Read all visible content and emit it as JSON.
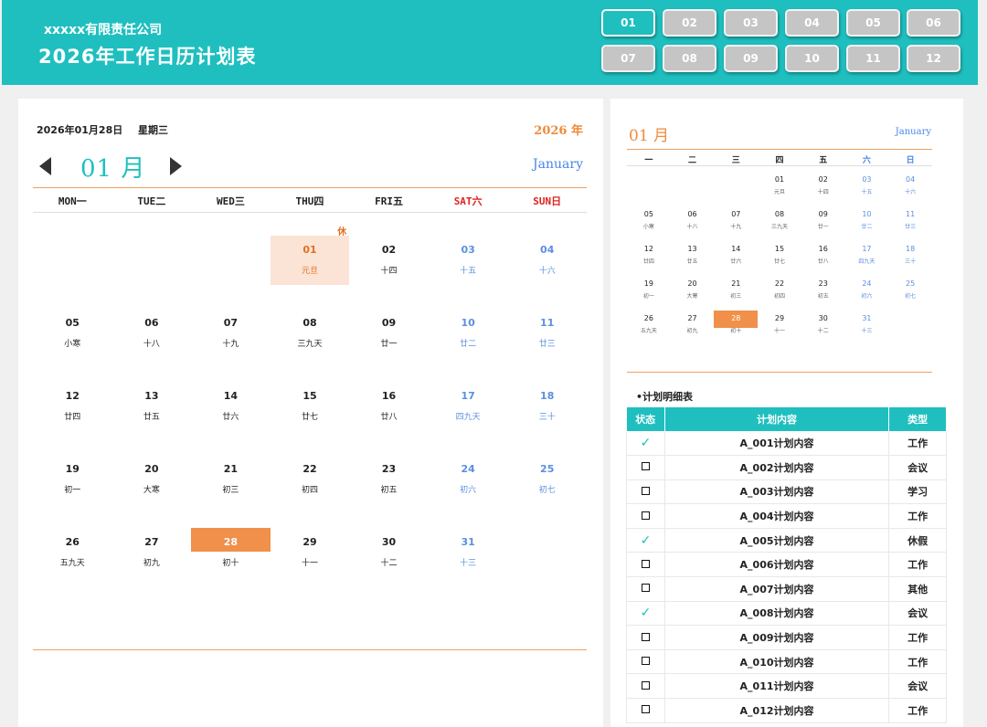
{
  "header": {
    "company": "xxxxx有限责任公司",
    "title": "2026年工作日历计划表",
    "months": [
      "01",
      "02",
      "03",
      "04",
      "05",
      "06",
      "07",
      "08",
      "09",
      "10",
      "11",
      "12"
    ],
    "active_month": "01"
  },
  "calendar": {
    "date": "2026年01月28日",
    "weekday": "星期三",
    "year": "2026 年",
    "month_cn": "01 月",
    "month_en": "January",
    "dow": [
      "MON一",
      "TUE二",
      "WED三",
      "THU四",
      "FRI五",
      "SAT六",
      "SUN日"
    ],
    "rest_label": "休",
    "days": [
      {
        "d": "",
        "l": ""
      },
      {
        "d": "",
        "l": ""
      },
      {
        "d": "",
        "l": ""
      },
      {
        "d": "01",
        "l": "元旦",
        "type": "holiday"
      },
      {
        "d": "02",
        "l": "十四"
      },
      {
        "d": "03",
        "l": "十五",
        "type": "weekend"
      },
      {
        "d": "04",
        "l": "十六",
        "type": "weekend"
      },
      {
        "d": "05",
        "l": "小寒"
      },
      {
        "d": "06",
        "l": "十八"
      },
      {
        "d": "07",
        "l": "十九"
      },
      {
        "d": "08",
        "l": "三九天"
      },
      {
        "d": "09",
        "l": "廿一"
      },
      {
        "d": "10",
        "l": "廿二",
        "type": "weekend"
      },
      {
        "d": "11",
        "l": "廿三",
        "type": "weekend"
      },
      {
        "d": "12",
        "l": "廿四"
      },
      {
        "d": "13",
        "l": "廿五"
      },
      {
        "d": "14",
        "l": "廿六"
      },
      {
        "d": "15",
        "l": "廿七"
      },
      {
        "d": "16",
        "l": "廿八"
      },
      {
        "d": "17",
        "l": "四九天",
        "type": "weekend"
      },
      {
        "d": "18",
        "l": "三十",
        "type": "weekend"
      },
      {
        "d": "19",
        "l": "初一"
      },
      {
        "d": "20",
        "l": "大寒"
      },
      {
        "d": "21",
        "l": "初三"
      },
      {
        "d": "22",
        "l": "初四"
      },
      {
        "d": "23",
        "l": "初五"
      },
      {
        "d": "24",
        "l": "初六",
        "type": "weekend"
      },
      {
        "d": "25",
        "l": "初七",
        "type": "weekend"
      },
      {
        "d": "26",
        "l": "五九天"
      },
      {
        "d": "27",
        "l": "初九"
      },
      {
        "d": "28",
        "l": "初十",
        "type": "today"
      },
      {
        "d": "29",
        "l": "十一"
      },
      {
        "d": "30",
        "l": "十二"
      },
      {
        "d": "31",
        "l": "十三",
        "type": "weekend"
      }
    ]
  },
  "mini": {
    "month_cn": "01 月",
    "month_en": "January",
    "dow": [
      "一",
      "二",
      "三",
      "四",
      "五",
      "六",
      "日"
    ],
    "days": [
      {
        "d": "",
        "l": ""
      },
      {
        "d": "",
        "l": ""
      },
      {
        "d": "",
        "l": ""
      },
      {
        "d": "01",
        "l": "元旦"
      },
      {
        "d": "02",
        "l": "十四"
      },
      {
        "d": "03",
        "l": "十五",
        "type": "weekend"
      },
      {
        "d": "04",
        "l": "十六",
        "type": "weekend"
      },
      {
        "d": "05",
        "l": "小寒"
      },
      {
        "d": "06",
        "l": "十八"
      },
      {
        "d": "07",
        "l": "十九"
      },
      {
        "d": "08",
        "l": "三九天"
      },
      {
        "d": "09",
        "l": "廿一"
      },
      {
        "d": "10",
        "l": "廿二",
        "type": "weekend"
      },
      {
        "d": "11",
        "l": "廿三",
        "type": "weekend"
      },
      {
        "d": "12",
        "l": "廿四"
      },
      {
        "d": "13",
        "l": "廿五"
      },
      {
        "d": "14",
        "l": "廿六"
      },
      {
        "d": "15",
        "l": "廿七"
      },
      {
        "d": "16",
        "l": "廿八"
      },
      {
        "d": "17",
        "l": "四九天",
        "type": "weekend"
      },
      {
        "d": "18",
        "l": "三十",
        "type": "weekend"
      },
      {
        "d": "19",
        "l": "初一"
      },
      {
        "d": "20",
        "l": "大寒"
      },
      {
        "d": "21",
        "l": "初三"
      },
      {
        "d": "22",
        "l": "初四"
      },
      {
        "d": "23",
        "l": "初五"
      },
      {
        "d": "24",
        "l": "初六",
        "type": "weekend"
      },
      {
        "d": "25",
        "l": "初七",
        "type": "weekend"
      },
      {
        "d": "26",
        "l": "五九天"
      },
      {
        "d": "27",
        "l": "初九"
      },
      {
        "d": "28",
        "l": "初十",
        "type": "today"
      },
      {
        "d": "29",
        "l": "十一"
      },
      {
        "d": "30",
        "l": "十二"
      },
      {
        "d": "31",
        "l": "十三",
        "type": "weekend"
      }
    ]
  },
  "plan": {
    "title": "•计划明细表",
    "headers": [
      "状态",
      "计划内容",
      "类型"
    ],
    "rows": [
      {
        "done": true,
        "content": "A_001计划内容",
        "type": "工作"
      },
      {
        "done": false,
        "content": "A_002计划内容",
        "type": "会议"
      },
      {
        "done": false,
        "content": "A_003计划内容",
        "type": "学习"
      },
      {
        "done": false,
        "content": "A_004计划内容",
        "type": "工作"
      },
      {
        "done": true,
        "content": "A_005计划内容",
        "type": "休假"
      },
      {
        "done": false,
        "content": "A_006计划内容",
        "type": "工作"
      },
      {
        "done": false,
        "content": "A_007计划内容",
        "type": "其他"
      },
      {
        "done": true,
        "content": "A_008计划内容",
        "type": "会议"
      },
      {
        "done": false,
        "content": "A_009计划内容",
        "type": "工作"
      },
      {
        "done": false,
        "content": "A_010计划内容",
        "type": "工作"
      },
      {
        "done": false,
        "content": "A_011计划内容",
        "type": "会议"
      },
      {
        "done": false,
        "content": "A_012计划内容",
        "type": "工作"
      }
    ]
  },
  "colors": {
    "accent": "#1fbfbf",
    "orange": "#f0904a",
    "weekend": "#5b8fe0",
    "holiday_bg": "#fbe4d6"
  }
}
